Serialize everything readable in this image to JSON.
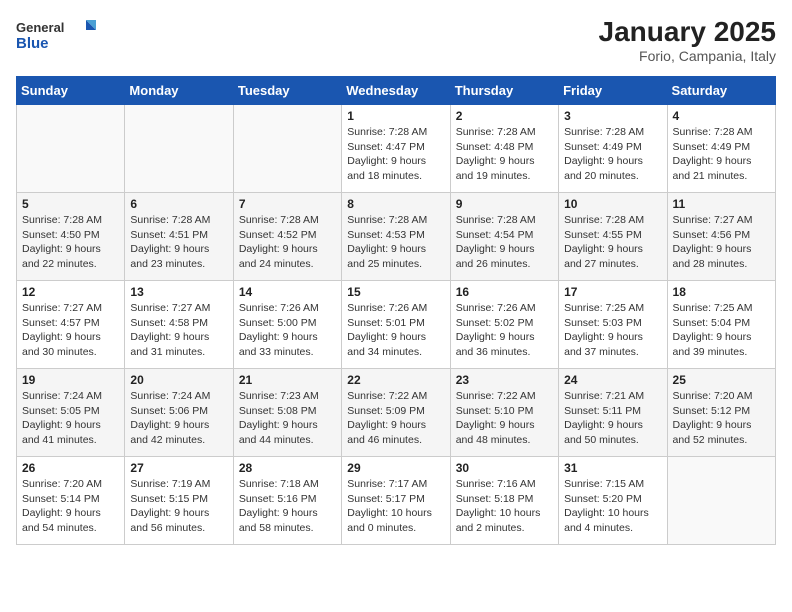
{
  "header": {
    "logo_general": "General",
    "logo_blue": "Blue",
    "title": "January 2025",
    "subtitle": "Forio, Campania, Italy"
  },
  "days_of_week": [
    "Sunday",
    "Monday",
    "Tuesday",
    "Wednesday",
    "Thursday",
    "Friday",
    "Saturday"
  ],
  "weeks": [
    {
      "stripe": false,
      "days": [
        {
          "num": "",
          "info": ""
        },
        {
          "num": "",
          "info": ""
        },
        {
          "num": "",
          "info": ""
        },
        {
          "num": "1",
          "info": "Sunrise: 7:28 AM\nSunset: 4:47 PM\nDaylight: 9 hours and 18 minutes."
        },
        {
          "num": "2",
          "info": "Sunrise: 7:28 AM\nSunset: 4:48 PM\nDaylight: 9 hours and 19 minutes."
        },
        {
          "num": "3",
          "info": "Sunrise: 7:28 AM\nSunset: 4:49 PM\nDaylight: 9 hours and 20 minutes."
        },
        {
          "num": "4",
          "info": "Sunrise: 7:28 AM\nSunset: 4:49 PM\nDaylight: 9 hours and 21 minutes."
        }
      ]
    },
    {
      "stripe": true,
      "days": [
        {
          "num": "5",
          "info": "Sunrise: 7:28 AM\nSunset: 4:50 PM\nDaylight: 9 hours and 22 minutes."
        },
        {
          "num": "6",
          "info": "Sunrise: 7:28 AM\nSunset: 4:51 PM\nDaylight: 9 hours and 23 minutes."
        },
        {
          "num": "7",
          "info": "Sunrise: 7:28 AM\nSunset: 4:52 PM\nDaylight: 9 hours and 24 minutes."
        },
        {
          "num": "8",
          "info": "Sunrise: 7:28 AM\nSunset: 4:53 PM\nDaylight: 9 hours and 25 minutes."
        },
        {
          "num": "9",
          "info": "Sunrise: 7:28 AM\nSunset: 4:54 PM\nDaylight: 9 hours and 26 minutes."
        },
        {
          "num": "10",
          "info": "Sunrise: 7:28 AM\nSunset: 4:55 PM\nDaylight: 9 hours and 27 minutes."
        },
        {
          "num": "11",
          "info": "Sunrise: 7:27 AM\nSunset: 4:56 PM\nDaylight: 9 hours and 28 minutes."
        }
      ]
    },
    {
      "stripe": false,
      "days": [
        {
          "num": "12",
          "info": "Sunrise: 7:27 AM\nSunset: 4:57 PM\nDaylight: 9 hours and 30 minutes."
        },
        {
          "num": "13",
          "info": "Sunrise: 7:27 AM\nSunset: 4:58 PM\nDaylight: 9 hours and 31 minutes."
        },
        {
          "num": "14",
          "info": "Sunrise: 7:26 AM\nSunset: 5:00 PM\nDaylight: 9 hours and 33 minutes."
        },
        {
          "num": "15",
          "info": "Sunrise: 7:26 AM\nSunset: 5:01 PM\nDaylight: 9 hours and 34 minutes."
        },
        {
          "num": "16",
          "info": "Sunrise: 7:26 AM\nSunset: 5:02 PM\nDaylight: 9 hours and 36 minutes."
        },
        {
          "num": "17",
          "info": "Sunrise: 7:25 AM\nSunset: 5:03 PM\nDaylight: 9 hours and 37 minutes."
        },
        {
          "num": "18",
          "info": "Sunrise: 7:25 AM\nSunset: 5:04 PM\nDaylight: 9 hours and 39 minutes."
        }
      ]
    },
    {
      "stripe": true,
      "days": [
        {
          "num": "19",
          "info": "Sunrise: 7:24 AM\nSunset: 5:05 PM\nDaylight: 9 hours and 41 minutes."
        },
        {
          "num": "20",
          "info": "Sunrise: 7:24 AM\nSunset: 5:06 PM\nDaylight: 9 hours and 42 minutes."
        },
        {
          "num": "21",
          "info": "Sunrise: 7:23 AM\nSunset: 5:08 PM\nDaylight: 9 hours and 44 minutes."
        },
        {
          "num": "22",
          "info": "Sunrise: 7:22 AM\nSunset: 5:09 PM\nDaylight: 9 hours and 46 minutes."
        },
        {
          "num": "23",
          "info": "Sunrise: 7:22 AM\nSunset: 5:10 PM\nDaylight: 9 hours and 48 minutes."
        },
        {
          "num": "24",
          "info": "Sunrise: 7:21 AM\nSunset: 5:11 PM\nDaylight: 9 hours and 50 minutes."
        },
        {
          "num": "25",
          "info": "Sunrise: 7:20 AM\nSunset: 5:12 PM\nDaylight: 9 hours and 52 minutes."
        }
      ]
    },
    {
      "stripe": false,
      "days": [
        {
          "num": "26",
          "info": "Sunrise: 7:20 AM\nSunset: 5:14 PM\nDaylight: 9 hours and 54 minutes."
        },
        {
          "num": "27",
          "info": "Sunrise: 7:19 AM\nSunset: 5:15 PM\nDaylight: 9 hours and 56 minutes."
        },
        {
          "num": "28",
          "info": "Sunrise: 7:18 AM\nSunset: 5:16 PM\nDaylight: 9 hours and 58 minutes."
        },
        {
          "num": "29",
          "info": "Sunrise: 7:17 AM\nSunset: 5:17 PM\nDaylight: 10 hours and 0 minutes."
        },
        {
          "num": "30",
          "info": "Sunrise: 7:16 AM\nSunset: 5:18 PM\nDaylight: 10 hours and 2 minutes."
        },
        {
          "num": "31",
          "info": "Sunrise: 7:15 AM\nSunset: 5:20 PM\nDaylight: 10 hours and 4 minutes."
        },
        {
          "num": "",
          "info": ""
        }
      ]
    }
  ]
}
